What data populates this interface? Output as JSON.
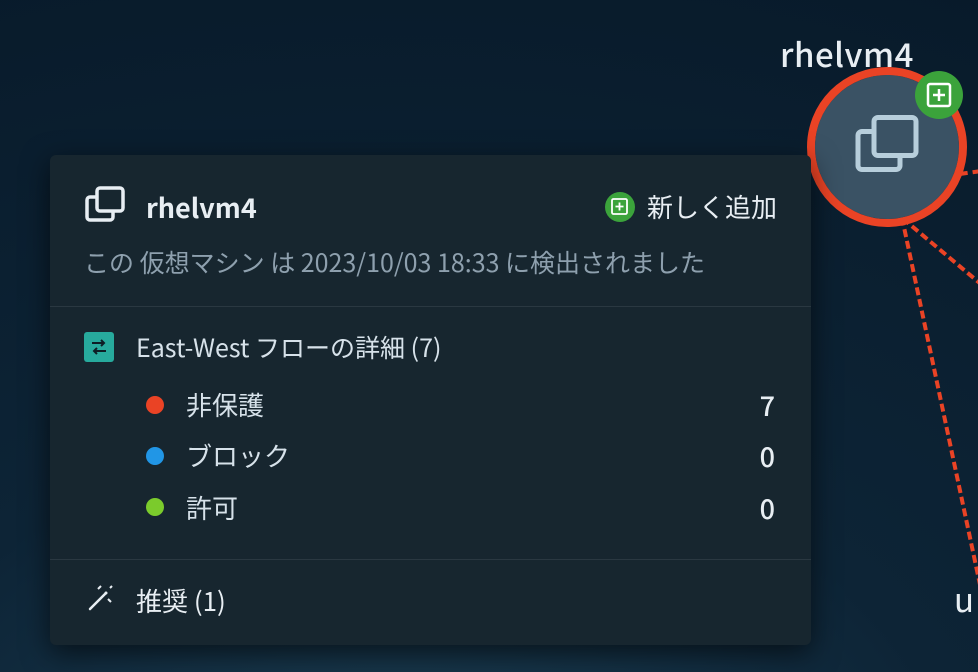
{
  "node": {
    "label": "rhelvm4"
  },
  "edge_label": "u",
  "card": {
    "title": "rhelvm4",
    "status_label": "新しく追加",
    "subtitle": "この 仮想マシン は 2023/10/03 18:33 に検出されました",
    "flow_section": {
      "title": "East-West フローの詳細 (7)",
      "items": [
        {
          "label": "非保護",
          "count": "7",
          "color": "#ea4325"
        },
        {
          "label": "ブロック",
          "count": "0",
          "color": "#2196e6"
        },
        {
          "label": "許可",
          "count": "0",
          "color": "#7bcb2c"
        }
      ]
    },
    "recommendation": {
      "label": "推奨 (1)"
    }
  },
  "colors": {
    "accent_red": "#ea4325",
    "accent_green": "#3ba33b",
    "accent_teal": "#27aa9d",
    "accent_blue": "#2196e6",
    "accent_lime": "#7bcb2c"
  }
}
